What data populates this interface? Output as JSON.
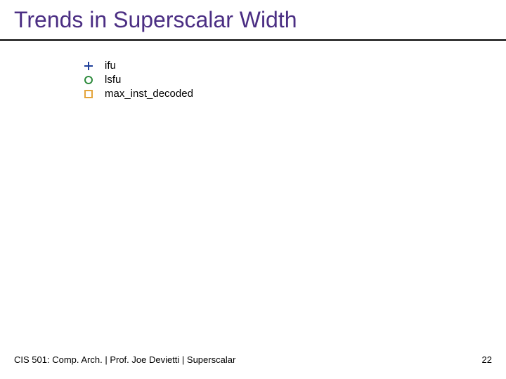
{
  "title": "Trends in Superscalar Width",
  "legend": {
    "items": [
      {
        "label": "ifu",
        "color": "#1f3f9a"
      },
      {
        "label": "lsfu",
        "color": "#2e8b3d"
      },
      {
        "label": "max_inst_decoded",
        "color": "#e4a43b"
      }
    ]
  },
  "footer": {
    "left": "CIS 501: Comp. Arch.  |  Prof. Joe Devietti  |  Superscalar",
    "page": "22"
  }
}
